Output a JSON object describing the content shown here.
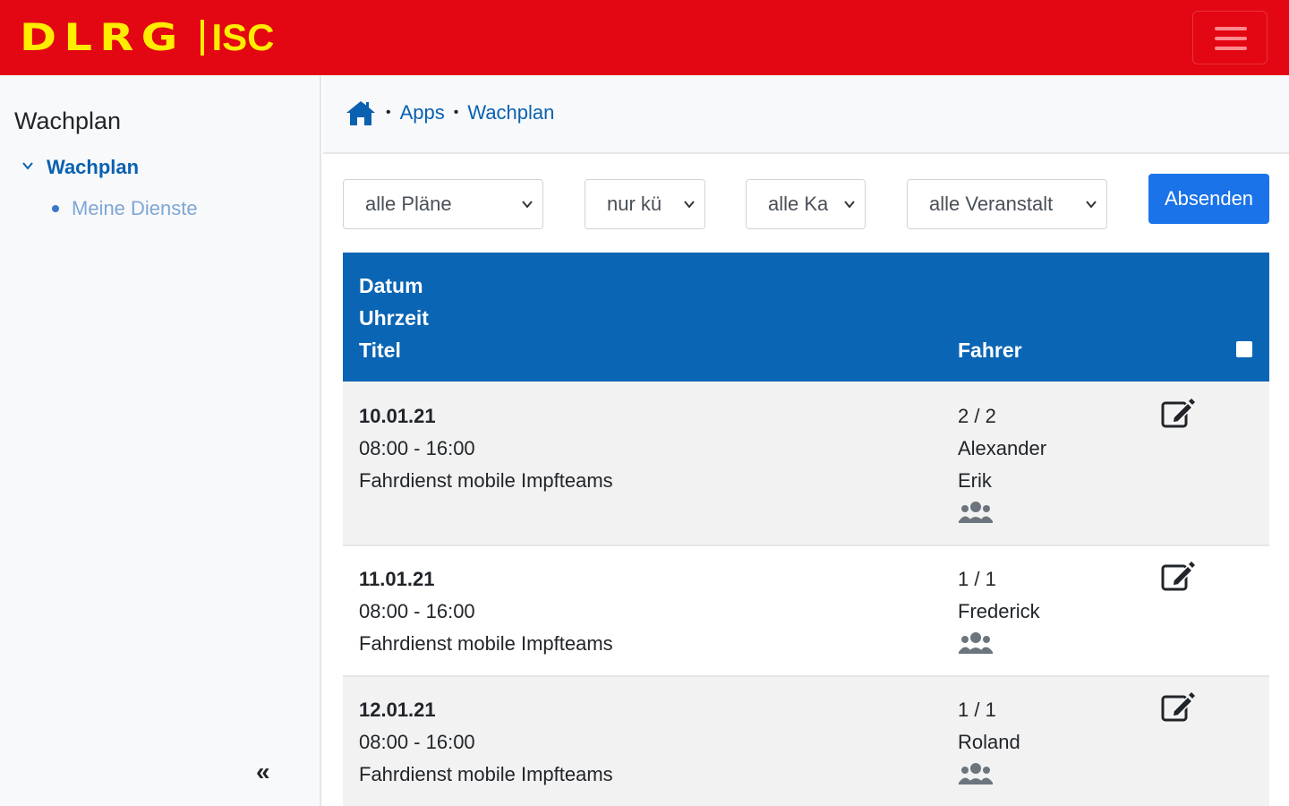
{
  "header": {
    "logo_primary": "DLRG",
    "logo_secondary": "ISC",
    "colors": {
      "brand_red": "#e30613",
      "brand_yellow": "#ffed00",
      "primary_blue": "#0a65b4"
    }
  },
  "sidebar": {
    "title": "Wachplan",
    "item": "Wachplan",
    "subitem": "Meine Dienste",
    "collapse_icon": "double-chevron-left-icon"
  },
  "breadcrumb": {
    "home_icon": "home-icon",
    "items": [
      "Apps",
      "Wachplan"
    ]
  },
  "filters": {
    "plans": "alle Pläne",
    "period": "nur kü",
    "category": "alle Ka",
    "events": "alle Veranstalt",
    "submit_label": "Absenden"
  },
  "table": {
    "headers": {
      "date": "Datum",
      "time": "Uhrzeit",
      "title": "Titel",
      "drivers": "Fahrer"
    },
    "rows": [
      {
        "date": "10.01.21",
        "time": "08:00 - 16:00",
        "title": "Fahrdienst mobile Impfteams",
        "count": "2 / 2",
        "drivers": [
          "Alexander",
          "Erik"
        ]
      },
      {
        "date": "11.01.21",
        "time": "08:00 - 16:00",
        "title": "Fahrdienst mobile Impfteams",
        "count": "1 / 1",
        "drivers": [
          "Frederick"
        ]
      },
      {
        "date": "12.01.21",
        "time": "08:00 - 16:00",
        "title": "Fahrdienst mobile Impfteams",
        "count": "1 / 1",
        "drivers": [
          "Roland"
        ]
      }
    ]
  }
}
